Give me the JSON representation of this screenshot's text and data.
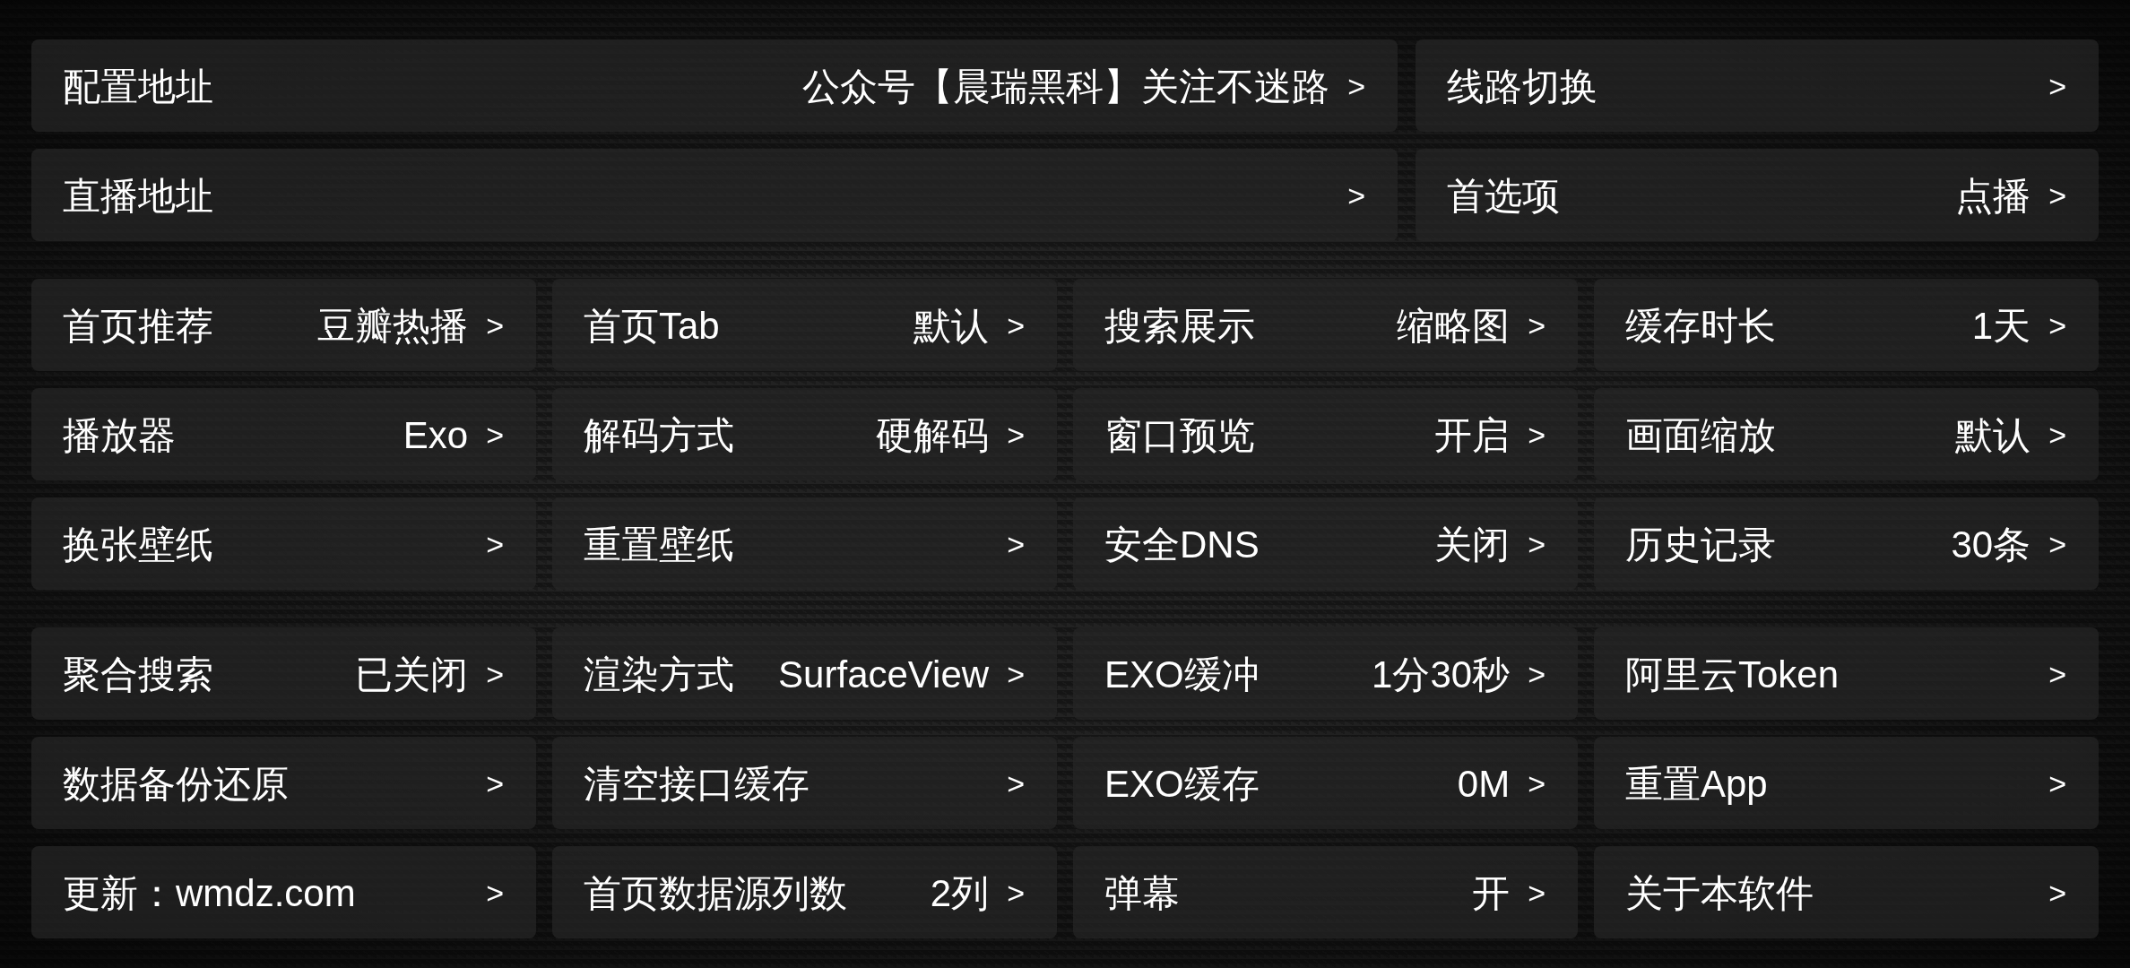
{
  "sections": [
    {
      "kind": "wide",
      "items": [
        {
          "label": "配置地址",
          "value": "公众号【晨瑞黑科】关注不迷路",
          "arrow": ">"
        },
        {
          "label": "线路切换",
          "arrow": ">"
        },
        {
          "label": "直播地址",
          "arrow": ">"
        },
        {
          "label": "首选项",
          "value": "点播",
          "arrow": ">"
        }
      ]
    },
    {
      "kind": "grid",
      "items": [
        {
          "label": "首页推荐",
          "value": "豆瓣热播",
          "arrow": ">"
        },
        {
          "label": "首页Tab",
          "value": "默认",
          "arrow": ">"
        },
        {
          "label": "搜索展示",
          "value": "缩略图",
          "arrow": ">"
        },
        {
          "label": "缓存时长",
          "value": "1天",
          "arrow": ">"
        },
        {
          "label": "播放器",
          "value": "Exo",
          "arrow": ">"
        },
        {
          "label": "解码方式",
          "value": "硬解码",
          "arrow": ">"
        },
        {
          "label": "窗口预览",
          "value": "开启",
          "arrow": ">"
        },
        {
          "label": "画面缩放",
          "value": "默认",
          "arrow": ">"
        },
        {
          "label": "换张壁纸",
          "arrow": ">"
        },
        {
          "label": "重置壁纸",
          "arrow": ">"
        },
        {
          "label": "安全DNS",
          "value": "关闭",
          "arrow": ">"
        },
        {
          "label": "历史记录",
          "value": "30条",
          "arrow": ">"
        }
      ]
    },
    {
      "kind": "grid",
      "items": [
        {
          "label": "聚合搜索",
          "value": "已关闭",
          "arrow": ">"
        },
        {
          "label": "渲染方式",
          "value": "SurfaceView",
          "arrow": ">"
        },
        {
          "label": "EXO缓冲",
          "value": "1分30秒",
          "arrow": ">"
        },
        {
          "label": "阿里云Token",
          "arrow": ">"
        },
        {
          "label": "数据备份还原",
          "arrow": ">"
        },
        {
          "label": "清空接口缓存",
          "arrow": ">"
        },
        {
          "label": "EXO缓存",
          "value": "0M",
          "arrow": ">"
        },
        {
          "label": "重置App",
          "arrow": ">"
        },
        {
          "label": "更新：wmdz.com",
          "arrow": ">"
        },
        {
          "label": "首页数据源列数",
          "value": "2列",
          "arrow": ">"
        },
        {
          "label": "弹幕",
          "value": "开",
          "arrow": ">"
        },
        {
          "label": "关于本软件",
          "arrow": ">"
        }
      ]
    }
  ]
}
